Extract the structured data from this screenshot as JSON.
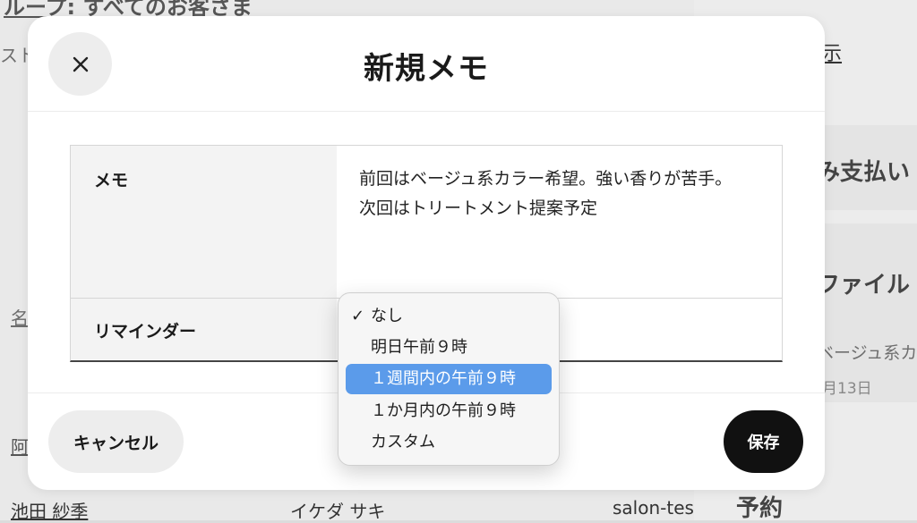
{
  "background": {
    "group_text": "ループ: すべてのお客さま",
    "list_text": "スト",
    "name_header": "名",
    "row1_name": "阿",
    "customer_name": "池田 紗季",
    "customer_kana": "イケダ サキ",
    "customer_id": "salon-test",
    "side_display": "示",
    "side_payment": "み支払い",
    "side_file": "ファイル",
    "side_memo": "ベージュ系カ",
    "side_date": "月13日",
    "side_reservation": "予約"
  },
  "modal": {
    "title": "新規メモ",
    "memo_label": "メモ",
    "memo_value": "前回はベージュ系カラー希望。強い香りが苦手。次回はトリートメント提案予定",
    "reminder_label": "リマインダー",
    "cancel_label": "キャンセル",
    "save_label": "保存"
  },
  "reminder_dropdown": {
    "options": [
      {
        "label": "なし",
        "checked": true,
        "highlighted": false
      },
      {
        "label": "明日午前９時",
        "checked": false,
        "highlighted": false
      },
      {
        "label": "１週間内の午前９時",
        "checked": false,
        "highlighted": true
      },
      {
        "label": "１か月内の午前９時",
        "checked": false,
        "highlighted": false
      },
      {
        "label": "カスタム",
        "checked": false,
        "highlighted": false
      }
    ],
    "check_mark": "✓"
  },
  "colors": {
    "highlight": "#5b9bea",
    "save_button": "#111111",
    "secondary_button": "#ededed"
  }
}
